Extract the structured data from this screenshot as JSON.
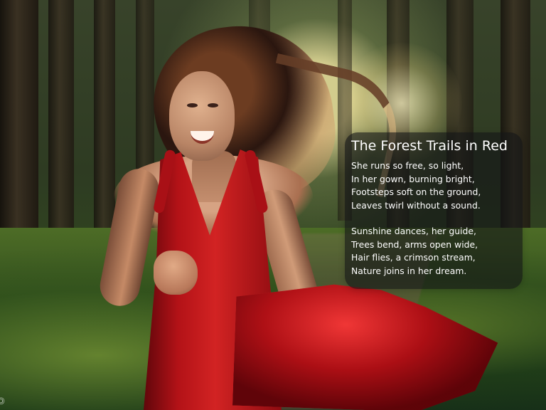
{
  "poem": {
    "title": "The Forest Trails in Red",
    "stanzas": [
      [
        "She runs so free, so light,",
        "In her gown, burning bright,",
        "Footsteps soft on the ground,",
        "Leaves twirl without a sound."
      ],
      [
        "Sunshine dances, her guide,",
        "Trees bend, arms open wide,",
        "Hair flies, a crimson stream,",
        "Nature joins in her dream."
      ]
    ]
  },
  "watermark": "© @udinarimoraa.com",
  "colors": {
    "dress": "#c9161b",
    "panel": "#151617",
    "text": "#ffffff"
  }
}
